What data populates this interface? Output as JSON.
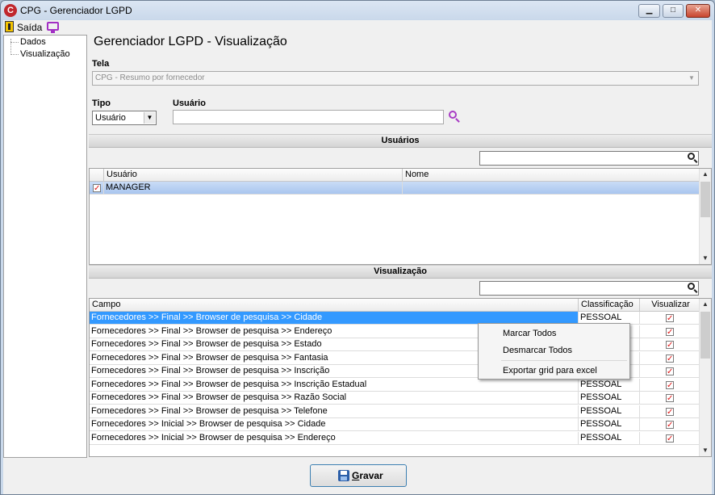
{
  "window": {
    "title": "CPG - Gerenciador LGPD",
    "logo_letter": "C",
    "min_symbol": "▁",
    "max_symbol": "□",
    "close_symbol": "✕"
  },
  "menu": {
    "exit_label": "Saída"
  },
  "tree": {
    "items": [
      "Dados",
      "Visualização"
    ]
  },
  "page": {
    "title": "Gerenciador LGPD - Visualização"
  },
  "form": {
    "tela_label": "Tela",
    "tela_value": "CPG - Resumo por fornecedor",
    "tipo_label": "Tipo",
    "tipo_value": "Usuário",
    "usuario_label": "Usuário",
    "usuario_value": ""
  },
  "users_section": {
    "header": "Usuários",
    "filter_value": "",
    "columns": [
      "Usuário",
      "Nome"
    ],
    "rows": [
      {
        "usuario": "MANAGER",
        "nome": "",
        "checked": true
      }
    ]
  },
  "view_section": {
    "header": "Visualização",
    "filter_value": "",
    "columns": [
      "Campo",
      "Classificação",
      "Visualizar"
    ],
    "rows": [
      {
        "campo": "Fornecedores >> Final >> Browser de pesquisa >> Cidade",
        "classificacao": "PESSOAL",
        "visualizar": true
      },
      {
        "campo": "Fornecedores >> Final >> Browser de pesquisa >> Endereço",
        "classificacao": "",
        "visualizar": true
      },
      {
        "campo": "Fornecedores >> Final >> Browser de pesquisa >> Estado",
        "classificacao": "",
        "visualizar": true
      },
      {
        "campo": "Fornecedores >> Final >> Browser de pesquisa >> Fantasia",
        "classificacao": "",
        "visualizar": true
      },
      {
        "campo": "Fornecedores >> Final >> Browser de pesquisa >> Inscrição",
        "classificacao": "",
        "visualizar": true
      },
      {
        "campo": "Fornecedores >> Final >> Browser de pesquisa >> Inscrição Estadual",
        "classificacao": "PESSOAL",
        "visualizar": true
      },
      {
        "campo": "Fornecedores >> Final >> Browser de pesquisa >> Razão Social",
        "classificacao": "PESSOAL",
        "visualizar": true
      },
      {
        "campo": "Fornecedores >> Final >> Browser de pesquisa >> Telefone",
        "classificacao": "PESSOAL",
        "visualizar": true
      },
      {
        "campo": "Fornecedores >> Inicial >> Browser de pesquisa >> Cidade",
        "classificacao": "PESSOAL",
        "visualizar": true
      },
      {
        "campo": "Fornecedores >> Inicial >> Browser de pesquisa >> Endereço",
        "classificacao": "PESSOAL",
        "visualizar": true
      }
    ]
  },
  "context_menu": {
    "items": [
      "Marcar Todos",
      "Desmarcar Todos",
      "Exportar grid para excel"
    ]
  },
  "footer": {
    "save_label_mnemonic": "G",
    "save_label_rest": "ravar"
  },
  "colors": {
    "accent": "#3399ff",
    "check": "#dd1111",
    "search_icon": "#a83cc4"
  }
}
